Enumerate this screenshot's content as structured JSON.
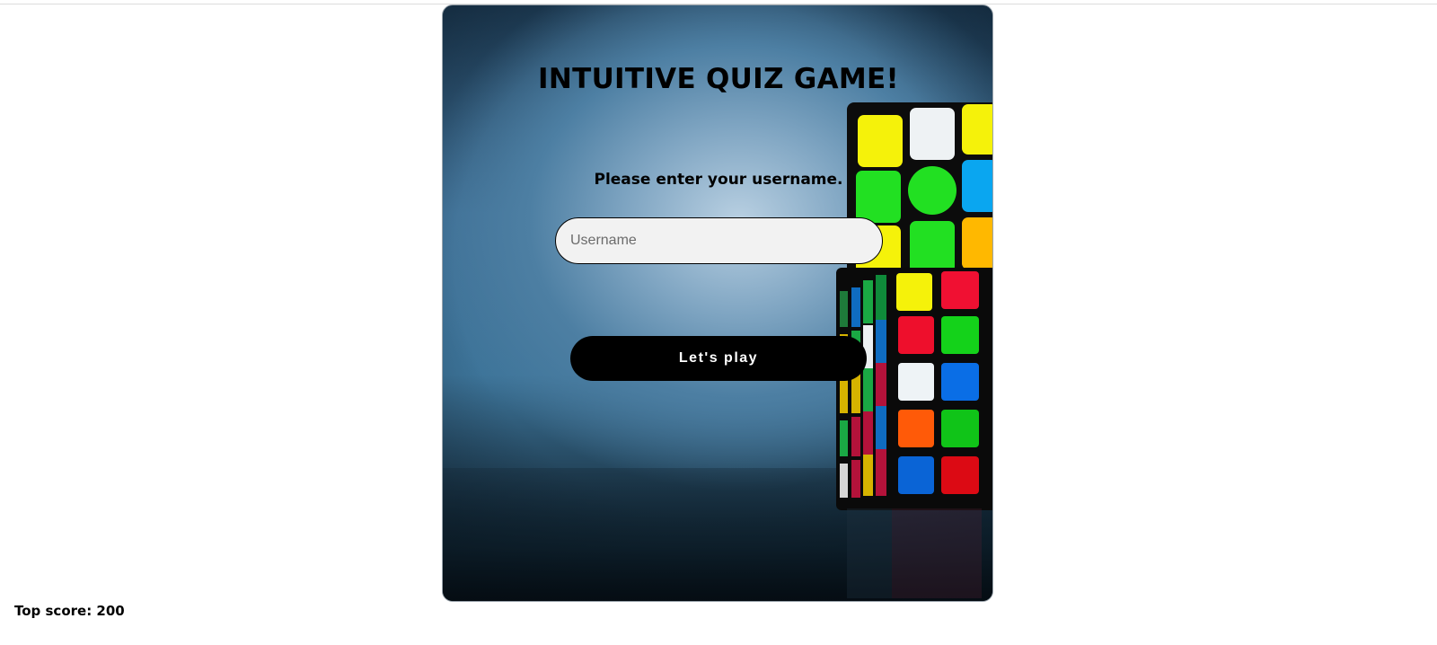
{
  "title": "INTUITIVE QUIZ GAME!",
  "prompt": "Please enter your username.",
  "username": {
    "placeholder": "Username",
    "value": ""
  },
  "play_button": "Let's play",
  "top_score": "Top score: 200",
  "colors": {
    "card_blue": "#3e6f95",
    "button_bg": "#000000",
    "input_bg": "#f2f2f2"
  },
  "background_image": "rubiks-cube-icon"
}
